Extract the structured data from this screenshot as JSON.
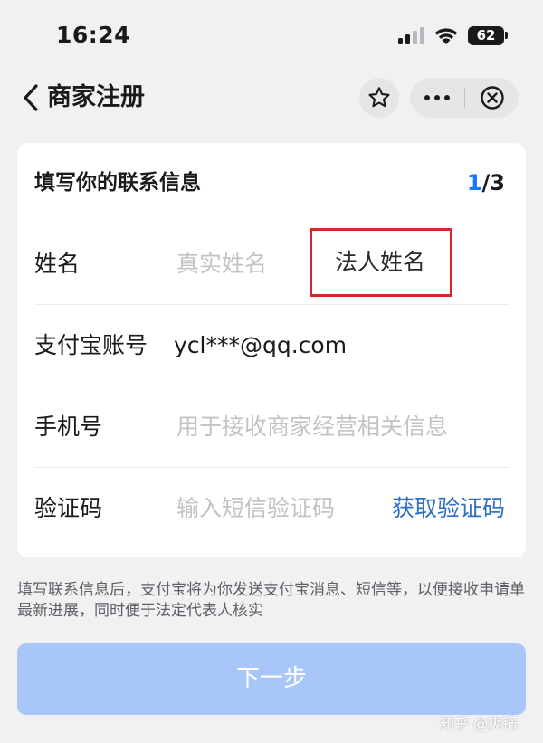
{
  "status_bar": {
    "time": "16:24",
    "battery": "62"
  },
  "nav": {
    "title": "商家注册"
  },
  "card": {
    "title": "填写你的联系信息",
    "step_current": "1",
    "step_total": "/3",
    "rows": [
      {
        "label": "姓名",
        "placeholder": "真实姓名",
        "annotation": "法人姓名"
      },
      {
        "label": "支付宝账号",
        "value": "ycl***@qq.com"
      },
      {
        "label": "手机号",
        "placeholder": "用于接收商家经营相关信息"
      },
      {
        "label": "验证码",
        "placeholder": "输入短信验证码",
        "action": "获取验证码"
      }
    ]
  },
  "note": "填写联系信息后，支付宝将为你发送支付宝消息、短信等，以便接收申请单最新进展，同时便于法定代表人核实",
  "next_button": "下一步",
  "watermark": "知乎 @爽锅",
  "colors": {
    "accent": "#1677ff",
    "link": "#2f6fc4",
    "button_disabled": "#a8c6f7",
    "annotation": "#d9262c"
  }
}
